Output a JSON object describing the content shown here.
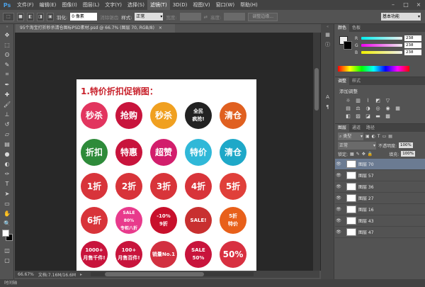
{
  "app": {
    "logo": "Ps"
  },
  "menubar": {
    "items": [
      "文件(F)",
      "编辑(E)",
      "图像(I)",
      "图层(L)",
      "文字(Y)",
      "选择(S)",
      "滤镜(T)",
      "3D(D)",
      "视图(V)",
      "窗口(W)",
      "帮助(H)"
    ],
    "active_index": 6,
    "window_controls": [
      "–",
      "□",
      "×"
    ]
  },
  "options": {
    "feather_label": "羽化:",
    "feather_value": "0 像素",
    "antialias_label": "消除锯齿",
    "style_label": "样式:",
    "style_value": "正常",
    "width_label": "宽度:",
    "height_label": "高度:",
    "refine_edge": "调整边缘...",
    "workspace": "基本功能"
  },
  "document": {
    "tab_title": "95个淘宝打折秒杀清仓图标PSD素材.psd @ 66.7% (图层 70, RGB/8)",
    "heading": "1.特价折扣促销图：",
    "row1": [
      {
        "text": "秒杀",
        "color": "#e2355f"
      },
      {
        "text": "抢购",
        "color": "#c8143c"
      },
      {
        "text": "秒杀",
        "color": "#f0a020"
      },
      {
        "text": "全民\n疯抢!",
        "color": "#222222"
      },
      {
        "text": "清仓",
        "color": "#e06020"
      }
    ],
    "row2": [
      {
        "text": "折扣",
        "color": "#2e8b3a"
      },
      {
        "text": "特惠",
        "color": "#c8143c"
      },
      {
        "text": "超赞",
        "color": "#d21e6c"
      },
      {
        "text": "特价",
        "color": "#30b8d8"
      },
      {
        "text": "清仓",
        "color": "#1ea8c8"
      }
    ],
    "row3": [
      {
        "text": "1折",
        "color": "#d8343a"
      },
      {
        "text": "2折",
        "color": "#d8343a"
      },
      {
        "text": "3折",
        "color": "#d8343a"
      },
      {
        "text": "4折",
        "color": "#d8343a"
      },
      {
        "text": "5折",
        "color": "#e0403a"
      }
    ],
    "row4": [
      {
        "text": "6折",
        "color": "#d8343a"
      },
      {
        "text": "SALE\n80%\n专柜八折",
        "color": "#e83a8c"
      },
      {
        "text": "-10%\n9折",
        "color": "#c8102c"
      },
      {
        "text": "SALE!",
        "color": "#c83030"
      },
      {
        "text": "5折\n特价",
        "color": "#e8601a"
      }
    ],
    "row5": [
      {
        "text": "1000+\n月售千件!",
        "color": "#c8143c"
      },
      {
        "text": "100+\n月售百件!",
        "color": "#c8143c"
      },
      {
        "text": "销量No.1",
        "color": "#d23040"
      },
      {
        "text": "SALE\n50%",
        "color": "#c8143c"
      },
      {
        "text": "50%",
        "color": "#d83040"
      }
    ]
  },
  "status": {
    "zoom": "66.67%",
    "doc_size": "文档:7.16M/16.6M"
  },
  "bottombar": {
    "label": "时间轴"
  },
  "color_panel": {
    "tabs": [
      "颜色",
      "色板"
    ],
    "r_label": "R",
    "g_label": "G",
    "b_label": "B",
    "r": "238",
    "g": "238",
    "b": "238"
  },
  "adjust_panel": {
    "tabs": [
      "调整",
      "样式"
    ],
    "title": "添加调整"
  },
  "layers_panel": {
    "tabs": [
      "图层",
      "通道",
      "路径"
    ],
    "kind": "类型",
    "blend_mode": "正常",
    "opacity_label": "不透明度:",
    "opacity": "100%",
    "lock_label": "锁定:",
    "fill_label": "填充:",
    "fill": "100%",
    "layers": [
      "图层 70",
      "图层 57",
      "图层 36",
      "图层 27",
      "图层 16",
      "图层 43",
      "图层 47"
    ]
  }
}
